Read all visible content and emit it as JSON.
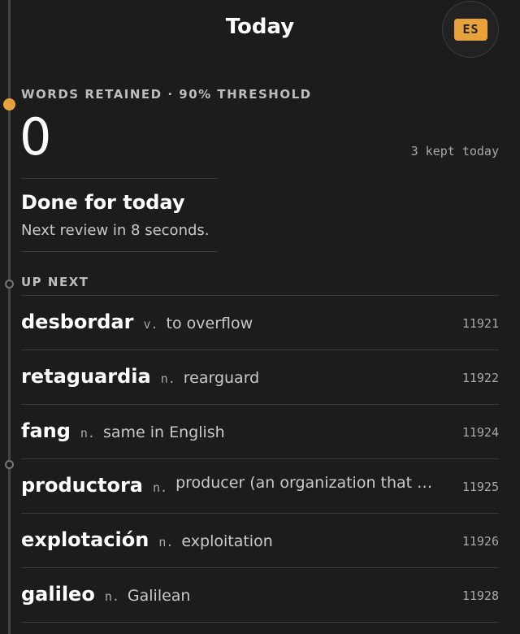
{
  "header": {
    "title": "Today"
  },
  "language": {
    "code": "ES"
  },
  "stats": {
    "label": "WORDS RETAINED · 90% THRESHOLD",
    "value": "0",
    "kept_today": "3 kept today"
  },
  "status": {
    "title": "Done for today",
    "subtitle": "Next review in 8 seconds."
  },
  "up_next": {
    "label": "UP NEXT",
    "items": [
      {
        "word": "desbordar",
        "pos": "v.",
        "definition": "to overflow",
        "id": "11921"
      },
      {
        "word": "retaguardia",
        "pos": "n.",
        "definition": "rearguard",
        "id": "11922"
      },
      {
        "word": "fang",
        "pos": "n.",
        "definition": "same in English",
        "id": "11924"
      },
      {
        "word": "productora",
        "pos": "n.",
        "definition": "producer (an organization that m…",
        "id": "11925"
      },
      {
        "word": "explotación",
        "pos": "n.",
        "definition": "exploitation",
        "id": "11926"
      },
      {
        "word": "galileo",
        "pos": "n.",
        "definition": "Galilean",
        "id": "11928"
      }
    ]
  },
  "colors": {
    "accent": "#e8a23b",
    "background": "#1c1c1c"
  }
}
